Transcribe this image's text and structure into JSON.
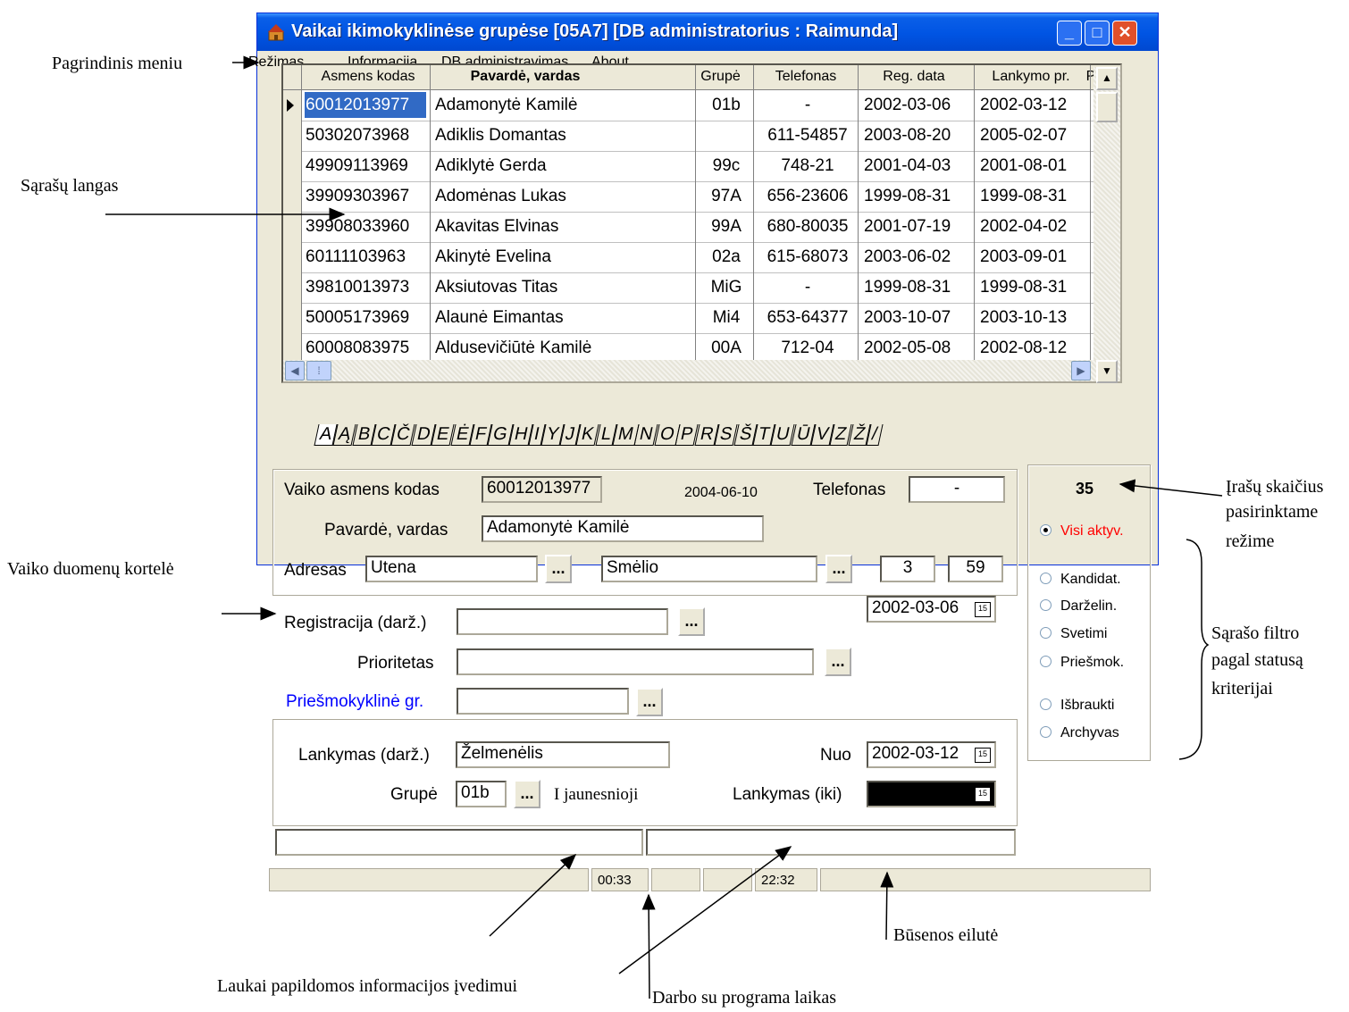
{
  "window": {
    "title": "Vaikai ikimokyklinėse grupėse [05A7] [DB administratorius : Raimunda]",
    "min_glyph": "_",
    "max_glyph": "□",
    "close_glyph": "✕"
  },
  "menu": [
    "Režimas",
    "Informacija",
    "DB administravimas",
    "About"
  ],
  "grid": {
    "headers": [
      "Asmens kodas",
      "Pavardė, vardas",
      "Grupė",
      "Telefonas",
      "Reg. data",
      "Lankymo pr.",
      "P"
    ],
    "rows": [
      [
        "60012013977",
        "Adamonytė Kamilė",
        "01b",
        "-",
        "2002-03-06",
        "2002-03-12",
        ""
      ],
      [
        "50302073968",
        "Adiklis Domantas",
        "",
        "611-54857",
        "2003-08-20",
        "2005-02-07",
        ""
      ],
      [
        "49909113969",
        "Adiklytė Gerda",
        "99c",
        "748-21",
        "2001-04-03",
        "2001-08-01",
        ""
      ],
      [
        "39909303967",
        "Adomėnas Lukas",
        "97A",
        "656-23606",
        "1999-08-31",
        "1999-08-31",
        "•"
      ],
      [
        "39908033960",
        "Akavitas Elvinas",
        "99A",
        "680-80035",
        "2001-07-19",
        "2002-04-02",
        ""
      ],
      [
        "60111103963",
        "Akinytė Evelina",
        "02a",
        "615-68073",
        "2003-06-02",
        "2003-09-01",
        ""
      ],
      [
        "39810013973",
        "Aksiutovas Titas",
        "MiG",
        "-",
        "1999-08-31",
        "1999-08-31",
        ""
      ],
      [
        "50005173969",
        "Alaunė Eimantas",
        "Mi4",
        "653-64377",
        "2003-10-07",
        "2003-10-13",
        ""
      ],
      [
        "60008083975",
        "Aldusevičiūtė Kamilė",
        "00A",
        "712-04",
        "2002-05-08",
        "2002-08-12",
        ""
      ]
    ]
  },
  "alphabet": [
    "A",
    "Ą",
    "B",
    "C",
    "Č",
    "D",
    "E",
    "Ė",
    "F",
    "G",
    "H",
    "I",
    "Y",
    "J",
    "K",
    "L",
    "M",
    "N",
    "O",
    "P",
    "R",
    "S",
    "Š",
    "T",
    "U",
    "Ū",
    "V",
    "Z",
    "Ž",
    "/"
  ],
  "card": {
    "code_label": "Vaiko asmens kodas",
    "code_value": "60012013977",
    "birth_date": "2004-06-10",
    "phone_label": "Telefonas",
    "phone_value": "-",
    "name_label": "Pavardė, vardas",
    "name_value": "Adamonytė Kamilė",
    "address_label": "Adresas",
    "city": "Utena",
    "street": "Smėlio",
    "house": "3",
    "flat": "59",
    "dots": "...",
    "reg_label": "Registracija (darž.)",
    "reg_value": "",
    "reg_date": "2002-03-06",
    "priority_label": "Prioritetas",
    "priority_value": "",
    "preschool_label": "Priešmokyklinė gr.",
    "preschool_value": "",
    "attend_label": "Lankymas (darž.)",
    "attend_value": "Želmenėlis",
    "from_label": "Nuo",
    "from_date": "2002-03-12",
    "group_label": "Grupė",
    "group_value": "01b",
    "group_name": "I jaunesnioji",
    "until_label": "Lankymas (iki)",
    "until_value": ""
  },
  "filter": {
    "count": "35",
    "options": [
      {
        "label": "Visi aktyv.",
        "checked": true
      },
      {
        "label": "Kandidat.",
        "checked": false
      },
      {
        "label": "Darželin.",
        "checked": false
      },
      {
        "label": "Svetimi",
        "checked": false
      },
      {
        "label": "Priešmok.",
        "checked": false
      },
      {
        "label": "Išbraukti",
        "checked": false
      },
      {
        "label": "Archyvas",
        "checked": false
      }
    ],
    "active_color": "#ff0000"
  },
  "status": {
    "time1": "00:33",
    "time2": "22:32"
  },
  "annotations": {
    "main_menu": "Pagrindinis meniu",
    "list_window": "Sąrašų langas",
    "child_card": "Vaiko duomenų kortelė",
    "count_1": "Įrašų skaičius",
    "count_2": "pasirinktame",
    "count_3": "režime",
    "filter_1": "Sąrašo filtro",
    "filter_2": "pagal statusą",
    "filter_3": "kriterijai",
    "extra_fields": "Laukai papildomos informacijos įvedimui",
    "work_time": "Darbo su programa laikas",
    "status_line": "Būsenos eilutė"
  },
  "colors": {
    "title_bar": "#0054e3",
    "selection": "#316ac5",
    "preschool_label": "#0000ff"
  }
}
